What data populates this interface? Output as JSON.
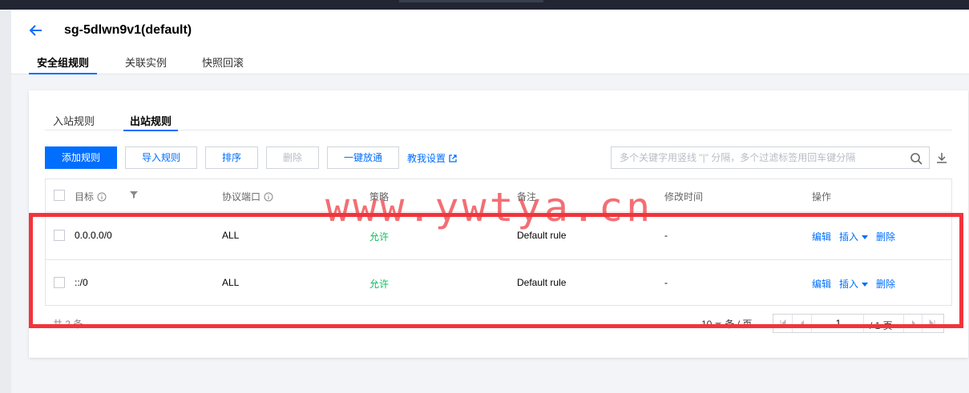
{
  "header": {
    "title": "sg-5dlwn9v1(default)",
    "tabs": [
      "安全组规则",
      "关联实例",
      "快照回滚"
    ]
  },
  "subtabs": [
    "入站规则",
    "出站规则"
  ],
  "toolbar": {
    "add": "添加规则",
    "import": "导入规则",
    "sort": "排序",
    "delete": "删除",
    "one_click": "一键放通",
    "tutorial": "教我设置",
    "search_placeholder": "多个关键字用竖线 \"|\" 分隔，多个过滤标签用回车键分隔"
  },
  "table": {
    "columns": [
      "目标",
      "协议端口",
      "策略",
      "备注",
      "修改时间",
      "操作"
    ],
    "rows": [
      {
        "target": "0.0.0.0/0",
        "protocol": "ALL",
        "policy": "允许",
        "remark": "Default rule",
        "modified": "-"
      },
      {
        "target": "::/0",
        "protocol": "ALL",
        "policy": "允许",
        "remark": "Default rule",
        "modified": "-"
      }
    ],
    "actions": {
      "edit": "编辑",
      "insert": "插入",
      "delete": "删除"
    }
  },
  "footer": {
    "total": "共 2 条",
    "page_size": "10",
    "per_page": "条 / 页",
    "page": "1",
    "page_total": "/ 1 页"
  },
  "watermark": "www.ywtya.cn",
  "colors": {
    "accent": "#006eff",
    "allow": "#0abf5b",
    "highlight": "#f2343b"
  }
}
